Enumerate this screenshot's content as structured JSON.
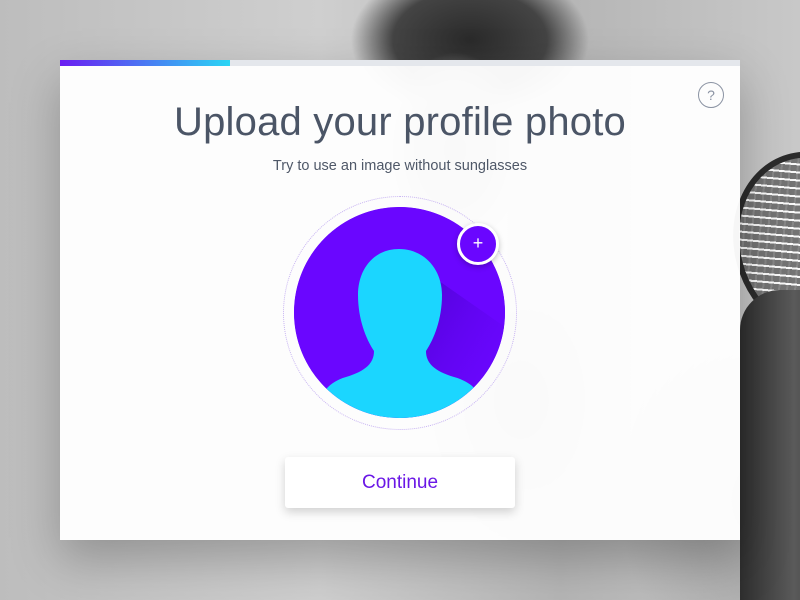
{
  "dialog": {
    "title": "Upload your profile photo",
    "subtitle": "Try to use an image without sunglasses",
    "help_label": "?",
    "progress": 0.25,
    "add_photo_label": "+",
    "continue_label": "Continue"
  },
  "icons": {
    "help": "question-mark-icon",
    "add_photo": "plus-icon",
    "avatar": "user-silhouette-icon"
  },
  "colors": {
    "accent": "#6a06ff",
    "silhouette": "#1bd6ff",
    "progress_start": "#6a1cf2",
    "progress_end": "#2ad6f4",
    "title_text": "#4b5566",
    "button_text": "#6a17e6"
  }
}
